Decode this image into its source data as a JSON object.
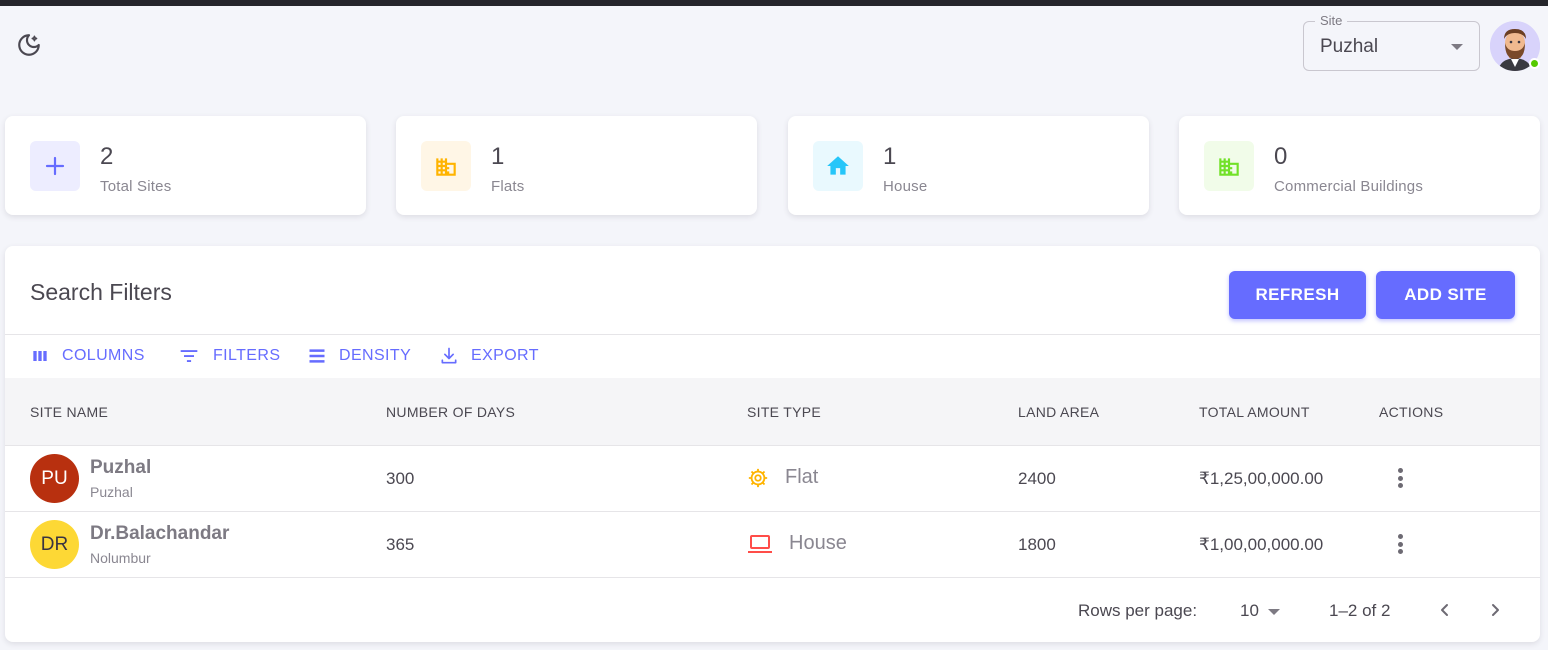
{
  "header": {
    "theme_toggle_icon": "moon-star-icon",
    "site_select": {
      "label": "Site",
      "value": "Puzhal"
    },
    "user_avatar": {
      "icon": "bearded-man-avatar",
      "status": "online",
      "status_color": "#56ca00"
    }
  },
  "stats": [
    {
      "value": "2",
      "label": "Total Sites",
      "icon": "plus-icon",
      "color": "#666cff",
      "bg": "#ededff"
    },
    {
      "value": "1",
      "label": "Flats",
      "icon": "building-icon",
      "color": "#ffb400",
      "bg": "#fff6e6"
    },
    {
      "value": "1",
      "label": "House",
      "icon": "home-icon",
      "color": "#26c6f9",
      "bg": "#e9f9fe"
    },
    {
      "value": "0",
      "label": "Commercial Buildings",
      "icon": "building-icon",
      "color": "#72e128",
      "bg": "#f1fce9"
    }
  ],
  "panel": {
    "title": "Search Filters",
    "refresh_label": "REFRESH",
    "add_label": "ADD SITE",
    "accent": "#666cff"
  },
  "toolbar": {
    "columns": "COLUMNS",
    "filters": "FILTERS",
    "density": "DENSITY",
    "export": "EXPORT"
  },
  "table": {
    "columns": [
      "SITE NAME",
      "NUMBER OF DAYS",
      "SITE TYPE",
      "LAND AREA",
      "TOTAL AMOUNT",
      "ACTIONS"
    ],
    "rows": [
      {
        "initials": "PU",
        "avatar_bg": "#b8300f",
        "avatar_fg": "#ffffff",
        "name": "Puzhal",
        "location": "Puzhal",
        "days": "300",
        "type": "Flat",
        "type_icon": "cog-icon",
        "type_color": "#ffb400",
        "land_area": "2400",
        "amount": "₹1,25,00,000.00"
      },
      {
        "initials": "DR",
        "avatar_bg": "#fdd835",
        "avatar_fg": "#3a3541",
        "name": "Dr.Balachandar",
        "location": "Nolumbur",
        "days": "365",
        "type": "House",
        "type_icon": "laptop-icon",
        "type_color": "#ff4d49",
        "land_area": "1800",
        "amount": "₹1,00,00,000.00"
      }
    ]
  },
  "pagination": {
    "rows_per_page_label": "Rows per page:",
    "rows_per_page": "10",
    "range": "1–2 of 2"
  }
}
